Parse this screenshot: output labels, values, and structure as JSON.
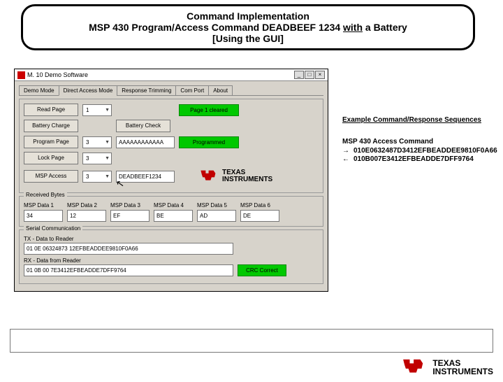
{
  "header": {
    "line1": "Command Implementation",
    "line2_prefix": "MSP 430 Program/Access Command DEADBEEF 1234 ",
    "line2_with": "with",
    "line2_suffix": " a Battery",
    "line3": "[Using the GUI]"
  },
  "gui": {
    "title": "M. 10 Demo Software",
    "tabs": [
      "Demo Mode",
      "Direct Access Mode",
      "Response Trimming",
      "Com Port",
      "About"
    ],
    "active_tab": 1,
    "rows": {
      "read_page": {
        "btn": "Read Page",
        "combo": "1",
        "status": "Page 1 cleared"
      },
      "battery_charge": {
        "btn": "Battery Charge",
        "btn2": "Battery Check"
      },
      "program_page": {
        "btn": "Program Page",
        "combo": "3",
        "input": "AAAAAAAAAAAA",
        "status": "Programmed"
      },
      "lock_page": {
        "btn": "Lock Page",
        "combo": "3"
      },
      "msp_access": {
        "btn": "MSP Access",
        "combo": "3",
        "input": "DEADBEEF1234"
      }
    },
    "received": {
      "legend": "Received Bytes",
      "cols": [
        {
          "label": "MSP Data 1",
          "val": "34"
        },
        {
          "label": "MSP Data 2",
          "val": "12"
        },
        {
          "label": "MSP Data 3",
          "val": "EF"
        },
        {
          "label": "MSP Data 4",
          "val": "BE"
        },
        {
          "label": "MSP Data 5",
          "val": "AD"
        },
        {
          "label": "MSP Data 6",
          "val": "DE"
        }
      ]
    },
    "serial": {
      "legend": "Serial Communication",
      "tx_label": "TX - Data to Reader",
      "tx_val": "01 0E 06324873 12EFBEADDEE9810F0A66",
      "rx_label": "RX - Data from Reader",
      "rx_val": "01 0B 00 7E3412EFBEADDE7DFF9764",
      "crc": "CRC Correct"
    }
  },
  "right": {
    "heading": "Example Command/Response Sequences",
    "title": "MSP 430 Access Command",
    "out_arrow": "→",
    "out": "010E0632487D3412EFBEADDEE9810F0A66",
    "in_arrow": "←",
    "in": "010B007E3412EFBEADDE7DFF9764"
  },
  "logo": {
    "brand_top": "TEXAS",
    "brand_bot": "INSTRUMENTS"
  }
}
